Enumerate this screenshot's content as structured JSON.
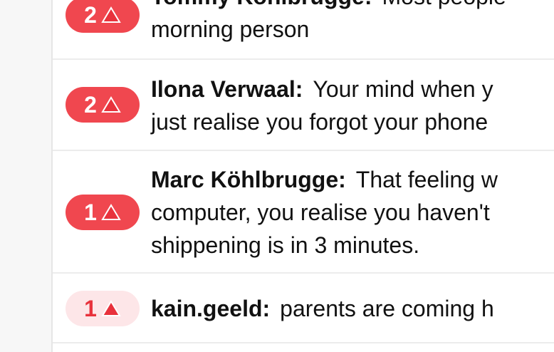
{
  "feed": {
    "items": [
      {
        "votes": "2",
        "voted": true,
        "author": "Tommy Köhlbrugge:",
        "lines": [
          "Most people",
          "morning person"
        ]
      },
      {
        "votes": "2",
        "voted": true,
        "author": "Ilona Verwaal:",
        "lines": [
          "Your mind when y",
          "just realise you forgot your phone"
        ]
      },
      {
        "votes": "1",
        "voted": true,
        "author": "Marc Köhlbrugge:",
        "lines": [
          "That feeling w",
          "computer, you realise you haven't",
          "shippening is in 3 minutes."
        ]
      },
      {
        "votes": "1",
        "voted": false,
        "author": "kain.geeld:",
        "lines": [
          "parents are coming h"
        ]
      }
    ]
  },
  "colors": {
    "vote_active_bg": "#f0474f",
    "vote_inactive_bg": "#fde6e8",
    "upvote_arrow": "#e8323c"
  },
  "icons": {
    "upvote": "upvote-triangle-icon"
  }
}
